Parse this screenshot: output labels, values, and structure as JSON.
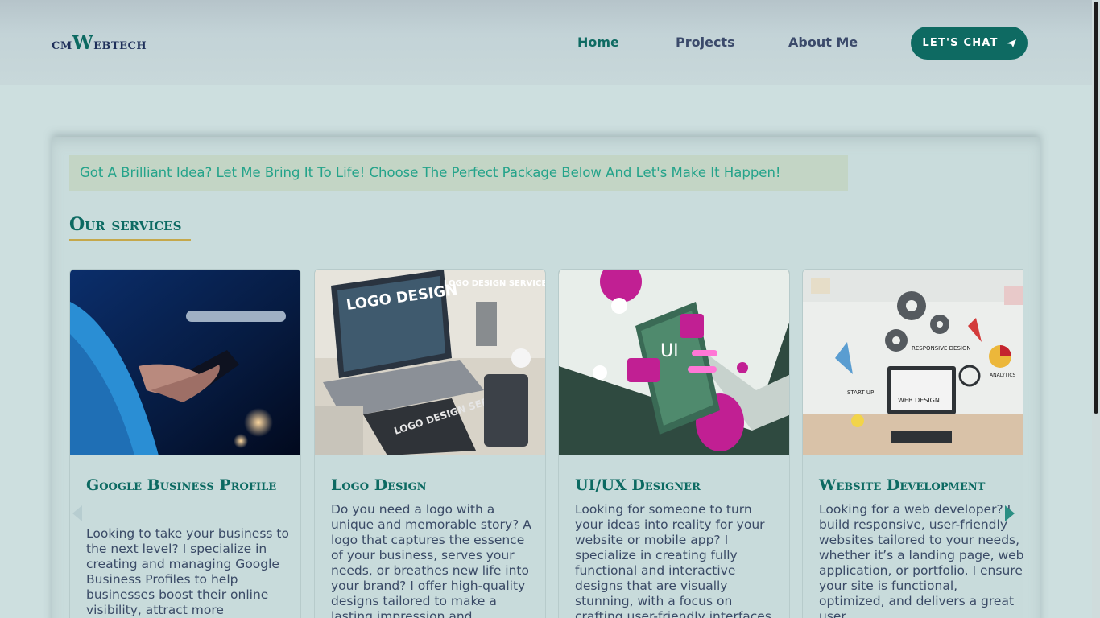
{
  "brand": {
    "prefix": "cm",
    "w": "W",
    "rest": "ebtech"
  },
  "nav": {
    "home": "Home",
    "projects": "Projects",
    "about": "About Me",
    "chat_label": "LET'S CHAT"
  },
  "promo": "Got A Brilliant Idea? Let Me Bring It To Life! Choose The Perfect Package Below And Let's Make It Happen!",
  "section_title": "Our services",
  "cards": [
    {
      "title": "Google Business Profile",
      "image_alt": "hands holding smartphone with search bar",
      "text": "Looking to take your business to the next level? I specialize in creating and managing Google Business Profiles to help businesses boost their online visibility, attract more"
    },
    {
      "title": "Logo Design",
      "image_alt": "laptop with logo design service mockups",
      "image_text": {
        "main": "LOGO DESIGN",
        "side": "LOGO DESIGN SERVICE",
        "tablet": "LOGO DESIGN SERVICE"
      },
      "text": "Do you need a logo with a unique and memorable story? A logo that captures the essence of your business, serves your needs, or breathes new life into your brand? I offer high-quality designs tailored to make a lasting impression and"
    },
    {
      "title": "UI/UX Designer",
      "image_alt": "phone with UI elements illustration",
      "image_text": {
        "ui": "UI"
      },
      "text": "Looking for someone to turn your ideas into reality for your website or mobile app? I specialize in creating fully functional and interactive designs that are visually stunning, with a focus on crafting user-friendly interfaces"
    },
    {
      "title": "Website Development",
      "image_alt": "web design sketch with gears and icons",
      "image_text": {
        "responsive": "RESPONSIVE DESIGN",
        "startup": "START UP",
        "webdesign": "WEB DESIGN",
        "analytics": "ANALYTICS"
      },
      "text": "Looking for a web developer? I build responsive, user-friendly websites tailored to your needs, whether it’s a landing page, web application, or portfolio. I ensure your site is functional, optimized, and delivers a great user"
    }
  ],
  "colors": {
    "accent": "#0e6a62",
    "promo_text": "#24a38a",
    "underline": "#c5a84b",
    "body_text": "#3a4a66"
  }
}
